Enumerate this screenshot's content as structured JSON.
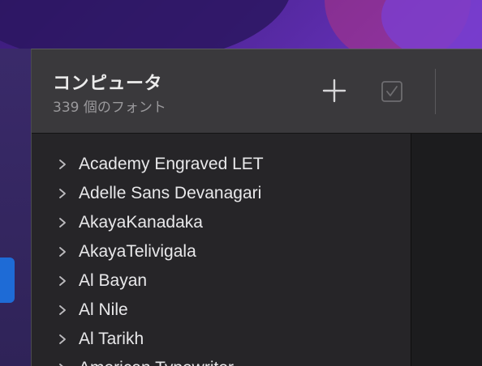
{
  "window": {
    "title": "コンピュータ",
    "subtitle": "339 個のフォント"
  },
  "toolbar": {
    "add_icon": "plus-icon",
    "validate_icon": "checkbox-check-icon"
  },
  "font_list": {
    "items": [
      {
        "name": "Academy Engraved LET"
      },
      {
        "name": "Adelle Sans Devanagari"
      },
      {
        "name": "AkayaKanadaka"
      },
      {
        "name": "AkayaTelivigala"
      },
      {
        "name": "Al Bayan"
      },
      {
        "name": "Al Nile"
      },
      {
        "name": "Al Tarikh"
      },
      {
        "name": "American Typewriter"
      }
    ]
  },
  "colors": {
    "toolbar_bg": "#3a393c",
    "list_bg": "#262528",
    "text": "#e8e8ea",
    "subtext": "#9a999c",
    "accent_blue": "#1e6bd6"
  }
}
